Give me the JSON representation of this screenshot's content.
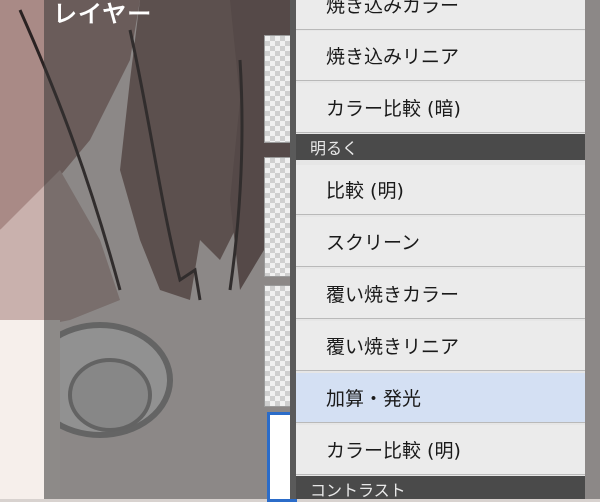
{
  "panel": {
    "title": "レイヤー"
  },
  "blend_menu": {
    "items_top": [
      "焼き込みカラー",
      "焼き込みリニア",
      "カラー比較 (暗)"
    ],
    "section_lighten": "明るく",
    "items_lighten": [
      "比較 (明)",
      "スクリーン",
      "覆い焼きカラー",
      "覆い焼きリニア",
      "加算・発光",
      "カラー比較 (明)"
    ],
    "selected_index": 4,
    "section_contrast": "コントラスト"
  }
}
